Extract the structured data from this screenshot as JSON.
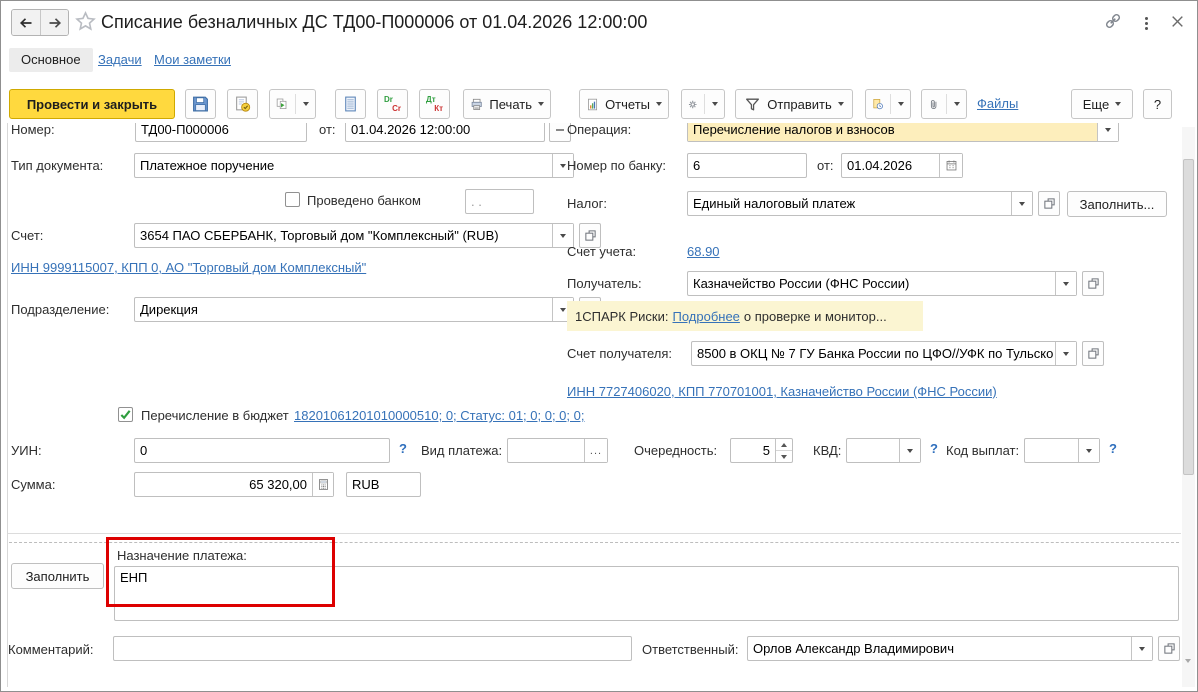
{
  "colors": {
    "accent_yellow_button": "#ffd93e",
    "link_blue": "#3672b8",
    "operation_field_yellow": "#fdeebc",
    "spark_box_yellow": "#fbf5d2",
    "annotation_red": "#dd0000",
    "checkbox_green": "#2f9e3f"
  },
  "window": {
    "title": "Списание безналичных ДС ТД00-П000006 от 01.04.2026 12:00:00",
    "tabs": [
      {
        "label": "Основное"
      },
      {
        "label": "Задачи"
      },
      {
        "label": "Мои заметки"
      }
    ]
  },
  "toolbar": {
    "post_and_close": "Провести и закрыть",
    "print_label": "Печать",
    "reports_label": "Отчеты",
    "send_label": "Отправить",
    "files_label": "Файлы",
    "more_label": "Еще",
    "help_label": "?",
    "dr": "Dr",
    "cr": "Cr",
    "dt": "Дт",
    "kt": "Кт"
  },
  "misc": {
    "from_label": "от:",
    "help": "?",
    "ellipsis": "..."
  },
  "form": {
    "number": {
      "label": "Номер:",
      "value": "ТД00-П000006",
      "datetime": "01.04.2026 12:00:00"
    },
    "operation": {
      "label": "Операция:",
      "value": "Перечисление налогов и взносов"
    },
    "doc_type": {
      "label": "Тип документа:",
      "value": "Платежное поручение"
    },
    "bank_number": {
      "label": "Номер по банку:",
      "value": "6",
      "date": "01.04.2026"
    },
    "bank_posted": {
      "label": "Проведено банком",
      "date_placeholder": ". ."
    },
    "tax": {
      "label": "Налог:",
      "value": "Единый налоговый платеж",
      "fill_button": "Заполнить..."
    },
    "account": {
      "label": "Счет:",
      "value": "3654 ПАО СБЕРБАНК, Торговый дом \"Комплексный\" (RUB)"
    },
    "payer_inn_link": "ИНН 9999115007, КПП 0, АО \"Торговый дом Комплексный\"",
    "accounting_account": {
      "label": "Счет учета:",
      "value": "68.90"
    },
    "recipient": {
      "label": "Получатель:",
      "value": "Казначейство России (ФНС России)"
    },
    "division": {
      "label": "Подразделение:",
      "value": "Дирекция"
    },
    "spark": {
      "prefix": "1СПАРК Риски:",
      "link": "Подробнее",
      "suffix": "о проверке и монитор..."
    },
    "recipient_account": {
      "label": "Счет получателя:",
      "value": "8500 в ОКЦ № 7 ГУ Банка России по ЦФО//УФК по Тульско"
    },
    "recipient_inn_link": "ИНН 7727406020, КПП 770701001, Казначейство России (ФНС России)",
    "budget": {
      "label": "Перечисление в бюджет",
      "link": "18201061201010000510; 0; Статус: 01; 0; 0; 0; 0;"
    },
    "uin": {
      "label": "УИН:",
      "value": "0"
    },
    "payment_kind": {
      "label": "Вид платежа:",
      "value": ""
    },
    "priority": {
      "label": "Очередность:",
      "value": "5"
    },
    "kvd": {
      "label": "КВД:",
      "value": ""
    },
    "payout_code": {
      "label": "Код выплат:",
      "value": ""
    },
    "amount": {
      "label": "Сумма:",
      "value": "65 320,00",
      "currency": "RUB"
    }
  },
  "bottom": {
    "fill_button": "Заполнить",
    "purpose": {
      "label": "Назначение платежа:",
      "value": "ЕНП"
    },
    "comment": {
      "label": "Комментарий:",
      "value": ""
    },
    "responsible": {
      "label": "Ответственный:",
      "value": "Орлов Александр Владимирович"
    }
  }
}
